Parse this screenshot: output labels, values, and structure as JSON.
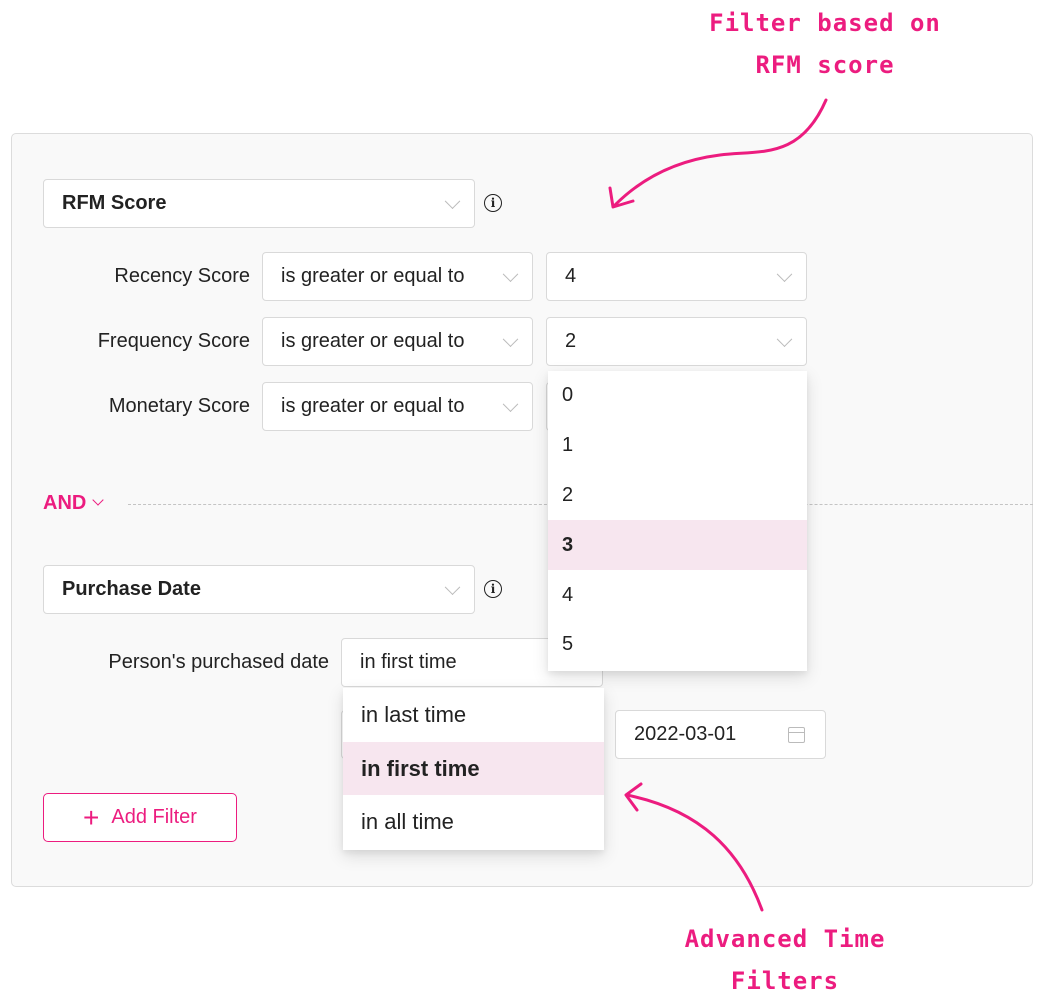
{
  "annotations": {
    "top": "Filter based on\nRFM score",
    "top_line1": "Filter based on",
    "top_line2": "RFM score",
    "bottom_line1": "Advanced Time",
    "bottom_line2": "Filters",
    "accent_color": "#ec1c7f"
  },
  "rfm_filter": {
    "field": "RFM Score",
    "rows": [
      {
        "label": "Recency Score",
        "operator": "is greater or equal to",
        "value": "4"
      },
      {
        "label": "Frequency Score",
        "operator": "is greater or equal to",
        "value": "2"
      },
      {
        "label": "Monetary Score",
        "operator": "is greater or equal to",
        "value": ""
      }
    ],
    "value_dropdown": {
      "options": [
        "0",
        "1",
        "2",
        "3",
        "4",
        "5"
      ],
      "highlighted": "3"
    }
  },
  "logic": {
    "operator": "AND"
  },
  "date_filter": {
    "field": "Purchase Date",
    "label": "Person's purchased date",
    "mode": "in first time",
    "mode_dropdown": {
      "options": [
        "in last time",
        "in first time",
        "in all time"
      ],
      "highlighted": "in first time"
    },
    "date_value": "2022-03-01"
  },
  "add_filter": {
    "label": "Add Filter"
  }
}
